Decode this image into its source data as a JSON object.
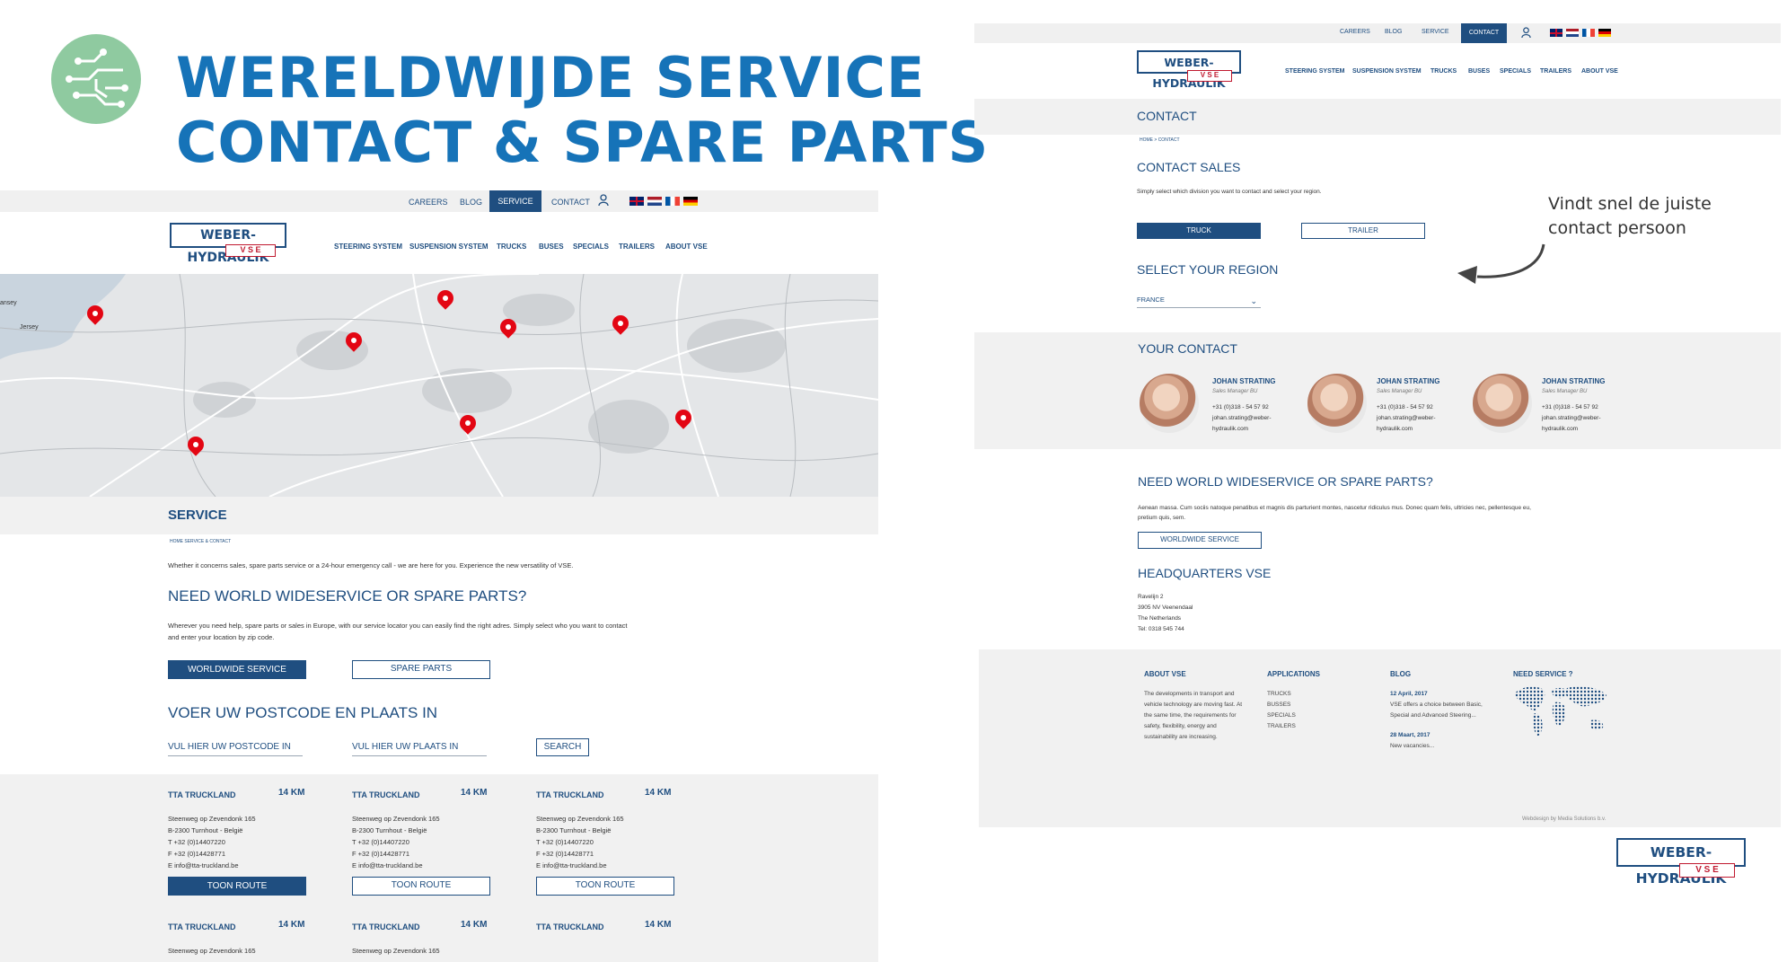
{
  "headline": {
    "line1": "WERELDWIJDE SERVICE",
    "line2": "CONTACT & SPARE PARTS"
  },
  "left": {
    "topnav": [
      "CAREERS",
      "BLOG",
      "SERVICE",
      "CONTACT"
    ],
    "mainnav": [
      "STEERING SYSTEM",
      "SUSPENSION SYSTEM",
      "TRUCKS",
      "BUSES",
      "SPECIALS",
      "TRAILERS",
      "ABOUT VSE"
    ],
    "map_labels": [
      "ansey",
      "Jersey"
    ],
    "page_title": "SERVICE",
    "breadcrumb": "HOME   SERVICE & CONTACT",
    "intro": "Whether it concerns sales, spare parts service or a 24-hour emergency call - we are here for you. Experience the new versatility of VSE.",
    "need_title": "NEED WORLD WIDESERVICE OR SPARE PARTS?",
    "need_text_1": "Wherever you need help, spare parts or sales in Europe, with our service locator you can easily find the right adres. Simply select who you want to contact",
    "need_text_2": "and enter your location by zip code.",
    "btn_worldwide": "WORLDWIDE SERVICE",
    "btn_spare": "SPARE PARTS",
    "postcode_title": "VOER UW POSTCODE EN PLAATS IN",
    "postcode_placeholder": "VUL HIER UW POSTCODE IN",
    "plaats_placeholder": "VUL HIER UW PLAATS IN",
    "search_label": "SEARCH",
    "cards": [
      {
        "name": "TTA TRUCKLAND",
        "km": "14 KM",
        "street": "Steenweg op Zevendonk 165",
        "city": "B-2300 Turnhout - België",
        "tel": "T +32 (0)14407220",
        "fax": "F +32 (0)14428771",
        "email": "E info@tta-truckland.be",
        "button": "TOON ROUTE"
      },
      {
        "name": "TTA TRUCKLAND",
        "km": "14 KM",
        "street": "Steenweg op Zevendonk 165",
        "city": "B-2300 Turnhout - België",
        "tel": "T +32 (0)14407220",
        "fax": "F +32 (0)14428771",
        "email": "E info@tta-truckland.be",
        "button": "TOON ROUTE"
      },
      {
        "name": "TTA TRUCKLAND",
        "km": "14 KM",
        "street": "Steenweg op Zevendonk 165",
        "city": "B-2300 Turnhout - België",
        "tel": "T +32 (0)14407220",
        "fax": "F +32 (0)14428771",
        "email": "E info@tta-truckland.be",
        "button": "TOON ROUTE"
      }
    ],
    "cards_row2": [
      {
        "name": "TTA TRUCKLAND",
        "km": "14 KM",
        "street": "Steenweg op Zevendonk 165"
      },
      {
        "name": "TTA TRUCKLAND",
        "km": "14 KM",
        "street": "Steenweg op Zevendonk 165"
      },
      {
        "name": "TTA TRUCKLAND",
        "km": "14 KM",
        "street": ""
      }
    ]
  },
  "right": {
    "topnav": [
      "CAREERS",
      "BLOG",
      "SERVICE",
      "CONTACT"
    ],
    "mainnav": [
      "STEERING SYSTEM",
      "SUSPENSION SYSTEM",
      "TRUCKS",
      "BUSES",
      "SPECIALS",
      "TRAILERS",
      "ABOUT VSE"
    ],
    "page_title": "CONTACT",
    "breadcrumb": "HOME > CONTACT",
    "sales_title": "CONTACT SALES",
    "sales_text": "Simply select which division you want to contact and select your region.",
    "btn_truck": "TRUCK",
    "btn_trailer": "TRAILER",
    "region_title": "SELECT YOUR REGION",
    "region_value": "FRANCE",
    "your_contact": "YOUR CONTACT",
    "contacts": [
      {
        "name": "JOHAN STRATING",
        "role": "Sales Manager BU",
        "phone": "+31 (0)318 - 54 57 92",
        "email1": "johan.strating@weber-",
        "email2": "hydraulik.com"
      },
      {
        "name": "JOHAN STRATING",
        "role": "Sales Manager BU",
        "phone": "+31 (0)318 - 54 57 92",
        "email1": "johan.strating@weber-",
        "email2": "hydraulik.com"
      },
      {
        "name": "JOHAN STRATING",
        "role": "Sales Manager BU",
        "phone": "+31 (0)318 - 54 57 92",
        "email1": "johan.strating@weber-",
        "email2": "hydraulik.com"
      }
    ],
    "need_title": "NEED WORLD WIDESERVICE OR SPARE PARTS?",
    "need_text_1": "Aenean massa. Cum sociis natoque penatibus et magnis dis parturient montes, nascetur ridiculus mus. Donec quam felis, ultricies nec, pellentesque eu,",
    "need_text_2": "pretium quis, sem.",
    "btn_worldwide": "WORLDWIDE SERVICE",
    "hq_title": "HEADQUARTERS VSE",
    "hq_lines": [
      "Ravelijn 2",
      "3905 NV Veenendaal",
      "The Netherlands",
      "Tel: 0318 545 744"
    ],
    "footer": {
      "about_h": "ABOUT VSE",
      "about_t": [
        "The developments in transport and",
        "vehicle technology are moving fast. At",
        "the same time, the requirements for",
        "safety, flexibility, energy and",
        "sustainability are increasing."
      ],
      "apps_h": "APPLICATIONS",
      "apps_t": [
        "TRUCKS",
        "BUSSES",
        "SPECIALS",
        "TRAILERS"
      ],
      "blog_h": "BLOG",
      "blog_d1": "12 April, 2017",
      "blog_t1": [
        "VSE offers a choice between Basic,",
        "Special and Advanced Steering..."
      ],
      "blog_d2": "28 Maart, 2017",
      "blog_t2": "New vacancies...",
      "need_h": "NEED SERVICE ?",
      "credit": "Webdesign by Media Solutions b.v."
    }
  },
  "annotation": {
    "line1": "Vindt snel de juiste",
    "line2": "contact persoon"
  },
  "logo": {
    "main": "WEBER-HYDRAULIK",
    "sub": "V S E"
  },
  "colors": {
    "navy": "#1f4e80",
    "headline_blue": "#1673b8",
    "pin_red": "#e30613",
    "badge_green": "#8fcaa0"
  }
}
